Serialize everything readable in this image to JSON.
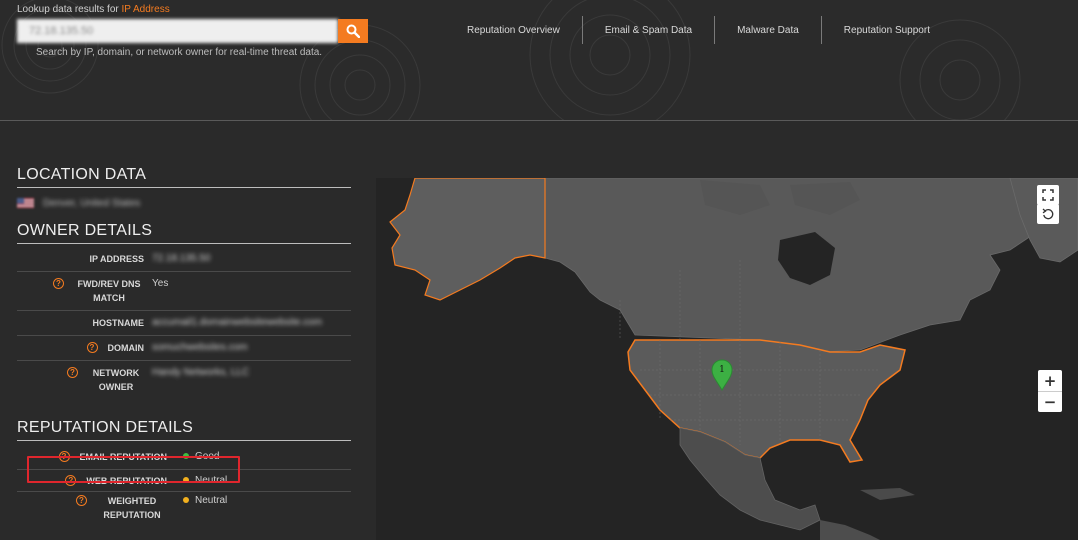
{
  "header": {
    "lookup_prefix": "Lookup data results for",
    "lookup_accent": "IP Address",
    "search_value": "72.18.135.50",
    "search_hint": "Search by IP, domain, or network owner for real-time threat data.",
    "search_icon": "search-icon",
    "nav": [
      {
        "label": "Reputation Overview"
      },
      {
        "label": "Email & Spam Data"
      },
      {
        "label": "Malware Data"
      },
      {
        "label": "Reputation Support"
      }
    ]
  },
  "location": {
    "title": "LOCATION DATA",
    "country": "Denver, United States"
  },
  "owner": {
    "title": "OWNER DETAILS",
    "rows": [
      {
        "label": "IP ADDRESS",
        "value": "72.18.135.50",
        "help": false,
        "blurred": true
      },
      {
        "label": "FWD/REV DNS MATCH",
        "value": "Yes",
        "help": true,
        "blurred": false
      },
      {
        "label": "HOSTNAME",
        "value": "accumail1.domainwebsitewebsite.com",
        "help": false,
        "blurred": true
      },
      {
        "label": "DOMAIN",
        "value": "somuchwebsites.com",
        "help": true,
        "blurred": true
      },
      {
        "label": "NETWORK OWNER",
        "value": "Handy Networks, LLC",
        "help": true,
        "blurred": true
      }
    ]
  },
  "reputation": {
    "title": "REPUTATION DETAILS",
    "rows": [
      {
        "label": "EMAIL REPUTATION",
        "value": "Good",
        "status_color": "#3fbf3f"
      },
      {
        "label": "WEB REPUTATION",
        "value": "Neutral",
        "status_color": "#f2b01e"
      },
      {
        "label": "WEIGHTED REPUTATION",
        "value": "Neutral",
        "status_color": "#f2b01e"
      }
    ]
  },
  "map": {
    "marker_count": "1",
    "zoom_in": "+",
    "zoom_out": "−",
    "fullscreen_icon": "fullscreen-icon",
    "reset_icon": "reset-view-icon"
  },
  "colors": {
    "accent": "#f47b20",
    "highlight": "#e0262d",
    "marker": "#3cb043"
  }
}
